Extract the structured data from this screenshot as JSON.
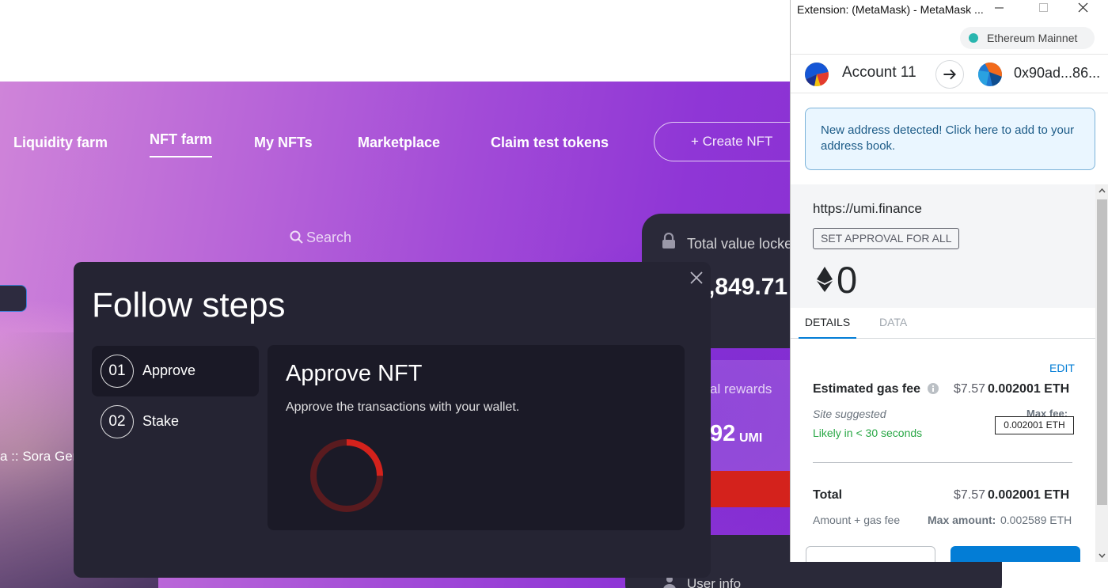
{
  "site": {
    "nav": {
      "items": [
        {
          "label": "Liquidity farm"
        },
        {
          "label": "NFT farm"
        },
        {
          "label": "My NFTs"
        },
        {
          "label": "Marketplace"
        },
        {
          "label": "Claim test tokens"
        }
      ],
      "active": "NFT farm",
      "create_button": "+ Create NFT"
    },
    "search_label": "Search",
    "partial_text": "a :: Sora Gen",
    "stats": {
      "tvl_label": "Total value locke",
      "tvl_value": ",849.71",
      "rewards_label": "al rewards",
      "rewards_value": "92",
      "rewards_unit": "UMI",
      "user_info_label": "User info"
    },
    "colors": {
      "accent_red": "#d4221c",
      "panel_dark": "#252433"
    }
  },
  "modal": {
    "title": "Follow steps",
    "steps": [
      {
        "number": "01",
        "label": "Approve",
        "active": true
      },
      {
        "number": "02",
        "label": "Stake",
        "active": false
      }
    ],
    "panel": {
      "title": "Approve NFT",
      "description": "Approve the transactions with your wallet."
    },
    "loading_progress": 0.25
  },
  "metamask": {
    "window_title": "Extension: (MetaMask) - MetaMask ...",
    "network": "Ethereum Mainnet",
    "from_account": "Account 11",
    "to_address": "0x90ad...86...",
    "alert": "New address detected! Click here to add to your address book.",
    "origin": "https://umi.finance",
    "method": "SET APPROVAL FOR ALL",
    "amount": "0",
    "tabs": [
      "DETAILS",
      "DATA"
    ],
    "active_tab": "DETAILS",
    "edit_label": "EDIT",
    "gas": {
      "label": "Estimated gas fee",
      "usd": "$7.57",
      "eth": "0.002001 ETH",
      "site_suggested": "Site suggested",
      "max_fee_label": "Max fee:",
      "max_fee_tooltip": "0.002001 ETH",
      "likely": "Likely in < 30 seconds"
    },
    "total": {
      "label": "Total",
      "usd": "$7.57",
      "eth": "0.002001 ETH",
      "amount_gas_label": "Amount + gas fee",
      "max_amount_label": "Max amount:",
      "max_amount_value": "0.002589 ETH"
    },
    "colors": {
      "primary": "#037dd6",
      "success": "#28a745",
      "network_dot": "#29b6af"
    }
  }
}
